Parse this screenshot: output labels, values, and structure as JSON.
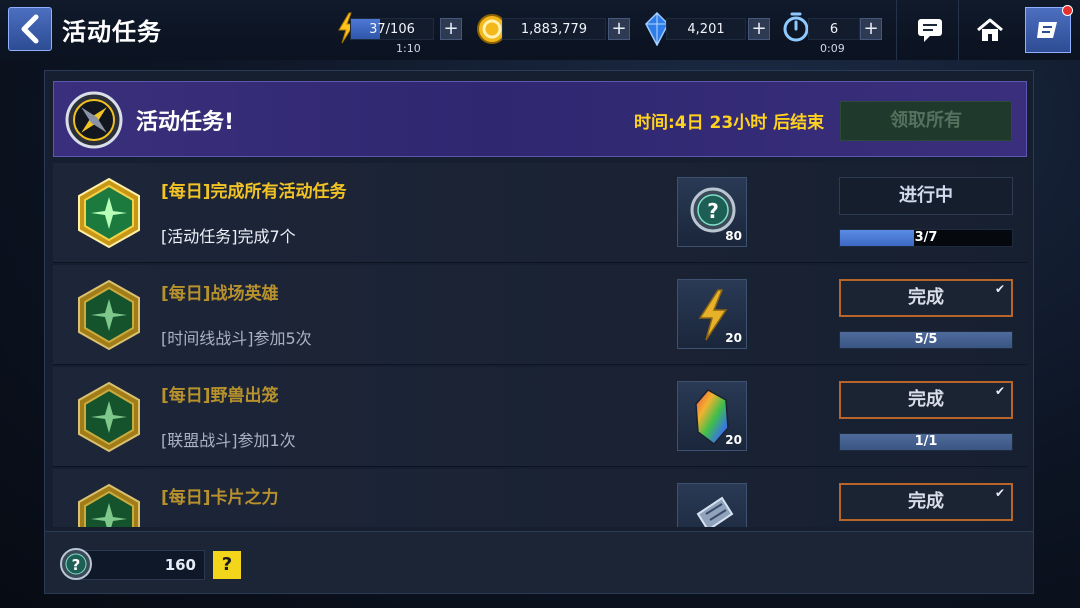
{
  "header": {
    "title": "活动任务",
    "resources": {
      "energy": {
        "value": "37/106",
        "timer": "1:10",
        "fill": 0.35
      },
      "gold": {
        "value": "1,883,779"
      },
      "crystal": {
        "value": "4,201"
      },
      "tickets": {
        "value": "6",
        "timer": "0:09"
      }
    },
    "plus_label": "+"
  },
  "banner": {
    "title": "活动任务!",
    "time_left": "时间:4日 23小时 后结束",
    "claim_all_label": "领取所有"
  },
  "tasks": [
    {
      "title": "[每日]完成所有活动任务",
      "desc": "[活动任务]完成7个",
      "reward_icon": "activity-token-icon",
      "reward_qty": "80",
      "status": "进行中",
      "progress_text": "3/7",
      "progress": 0.43,
      "completed": false
    },
    {
      "title": "[每日]战场英雄",
      "desc": "[时间线战斗]参加5次",
      "reward_icon": "energy-bolt-icon",
      "reward_qty": "20",
      "status": "完成",
      "progress_text": "5/5",
      "progress": 1.0,
      "completed": true
    },
    {
      "title": "[每日]野兽出笼",
      "desc": "[联盟战斗]参加1次",
      "reward_icon": "rainbow-crystal-icon",
      "reward_qty": "20",
      "status": "完成",
      "progress_text": "1/1",
      "progress": 1.0,
      "completed": true
    },
    {
      "title": "[每日]卡片之力",
      "desc": "",
      "reward_icon": "card-pack-icon",
      "reward_qty": "",
      "status": "完成",
      "progress_text": "",
      "progress": 1.0,
      "completed": true
    }
  ],
  "footer": {
    "token_value": "160",
    "help_label": "?"
  },
  "colors": {
    "accent_blue": "#3d5fae",
    "banner_purple": "#2f2770",
    "title_gold": "#f2c325",
    "time_yellow": "#ffd21f",
    "complete_border": "#b8652a",
    "progress_blue": "#5b8de6"
  }
}
